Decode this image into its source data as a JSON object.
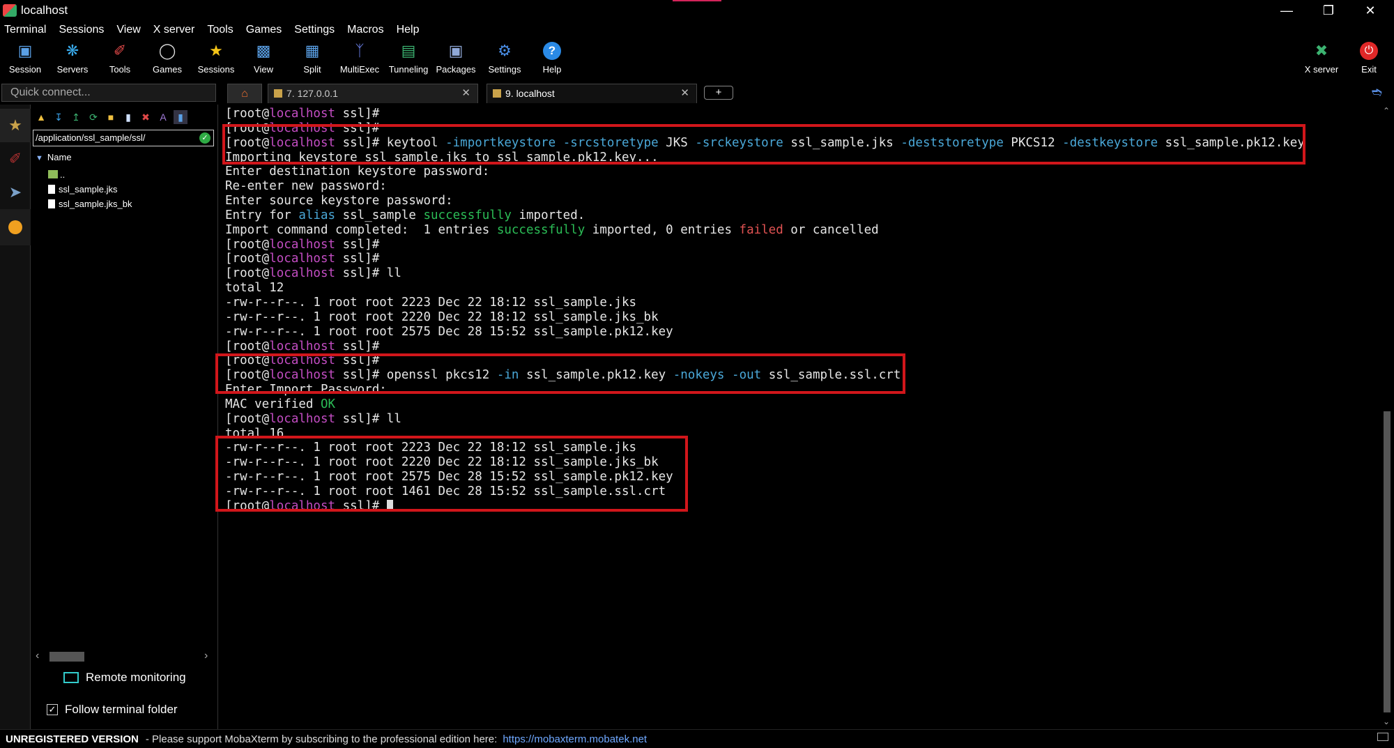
{
  "window": {
    "title": "localhost"
  },
  "menu": [
    "Terminal",
    "Sessions",
    "View",
    "X server",
    "Tools",
    "Games",
    "Settings",
    "Macros",
    "Help"
  ],
  "toolbar": {
    "buttons": [
      "Session",
      "Servers",
      "Tools",
      "Games",
      "Sessions",
      "View",
      "Split",
      "MultiExec",
      "Tunneling",
      "Packages",
      "Settings",
      "Help"
    ],
    "right_buttons": [
      "X server",
      "Exit"
    ]
  },
  "quick_connect": {
    "placeholder": "Quick connect..."
  },
  "tabs": [
    {
      "label": "7. 127.0.0.1"
    },
    {
      "label": "9. localhost"
    }
  ],
  "sidebar": {
    "path": "/application/ssl_sample/ssl/",
    "tree_header": "Name",
    "items": [
      "..",
      "ssl_sample.jks",
      "ssl_sample.jks_bk"
    ],
    "remote_monitoring": "Remote monitoring",
    "follow_terminal_folder": "Follow terminal folder"
  },
  "terminal": {
    "prompt_user": "[root@",
    "prompt_host": "localhost",
    "prompt_dir": " ssl]#",
    "cmd_keytool": " keytool -importkeystore -srcstoretype JKS -srckeystore ssl_sample.jks -deststoretype PKCS12 -destkeystore ssl_sample.pk12.key",
    "importing": "Importing keystore ssl_sample.jks to ssl_sample.pk12.key...",
    "enter_dest": "Enter destination keystore password:",
    "reenter": "Re-enter new password:",
    "enter_src": "Enter source keystore password:",
    "entry_for": "Entry for ",
    "alias": "alias",
    "ssl_sample": " ssl_sample ",
    "successfully": "successfully",
    "imported": " imported.",
    "import_completed": "Import command completed:  1 entries ",
    "imported_0": " imported, 0 entries ",
    "failed": "failed",
    "or_cancelled": " or cancelled",
    "cmd_ll": " ll",
    "total12": "total 12",
    "ls1": "-rw-r--r--. 1 root root 2223 Dec 22 18:12 ssl_sample.jks",
    "ls2": "-rw-r--r--. 1 root root 2220 Dec 22 18:12 ssl_sample.jks_bk",
    "ls3": "-rw-r--r--. 1 root root 2575 Dec 28 15:52 ssl_sample.pk12.key",
    "cmd_openssl": " openssl pkcs12 -in ssl_sample.pk12.key -nokeys -out ssl_sample.ssl.crt",
    "enter_import": "Enter Import Password:",
    "mac_verified": "MAC verified ",
    "ok": "OK",
    "total16": "total 16",
    "ls4": "-rw-r--r--. 1 root root 1461 Dec 28 15:52 ssl_sample.ssl.crt"
  },
  "status": {
    "unregistered": "UNREGISTERED VERSION",
    "message": "-  Please support MobaXterm by subscribing to the professional edition here:",
    "link": "https://mobaxterm.mobatek.net"
  },
  "colors": {
    "host": "#c34dc3",
    "option": "#4aa8d8",
    "success": "#2bbd56",
    "failed": "#e05252",
    "highlight_box": "#d1161b"
  }
}
